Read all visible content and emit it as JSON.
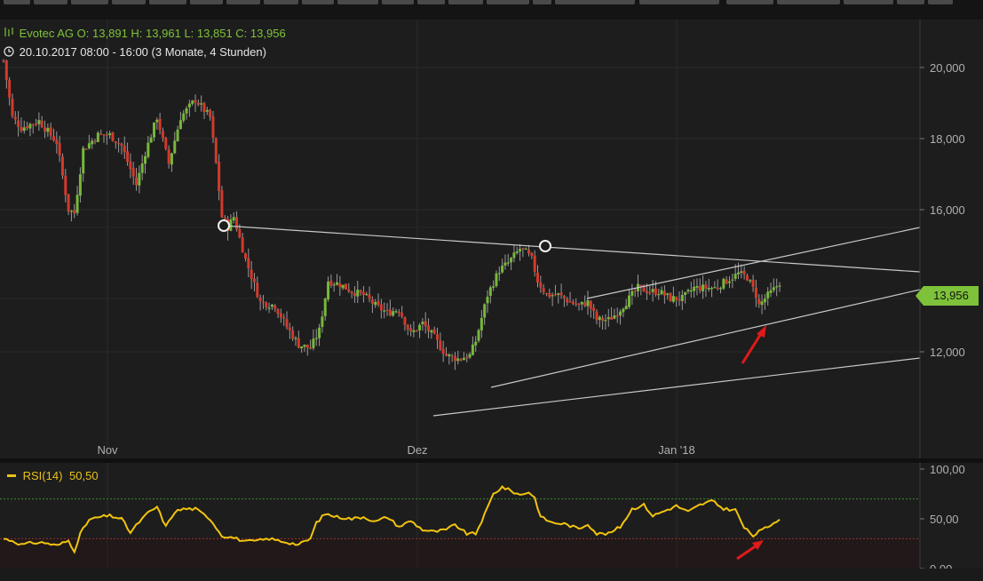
{
  "toolbar": {
    "button_count": 13
  },
  "instrument": {
    "name": "Evotec AG",
    "open_label": "O:",
    "open": "13,891",
    "high_label": "H:",
    "high": "13,961",
    "low_label": "L:",
    "low": "13,851",
    "close_label": "C:",
    "close": "13,956"
  },
  "session": {
    "text": "20.10.2017 08:00 - 16:00",
    "range": "(3 Monate, 4 Stunden)"
  },
  "colors": {
    "background": "#1d1d1d",
    "up_candle": "#76b83a",
    "down_candle": "#d23a2c",
    "wick": "#9a9a9a",
    "trendline": "#c8c8c8",
    "rsi_line": "#f1c30f",
    "rsi_upper_level": "#3c8a2c",
    "rsi_lower_level": "#9c2f2f",
    "annotation_arrow": "#e01a1a",
    "price_badge": "#7dc23a"
  },
  "chart_data": [
    {
      "type": "candlestick",
      "title": "Evotec AG",
      "y_axis_ticks": [
        "20,000",
        "18,000",
        "16,000",
        "12,000"
      ],
      "y_tick_values": [
        20,
        18,
        16,
        12
      ],
      "ylim": [
        10.3,
        21.3
      ],
      "x_tick_labels": [
        "Nov",
        "Dez",
        "Jan '18"
      ],
      "last_price_label": "13,956",
      "last_price": 13.956,
      "price_path": [
        [
          0,
          20.2
        ],
        [
          3,
          18.6
        ],
        [
          6,
          18.3
        ],
        [
          12,
          18.5
        ],
        [
          18,
          17.9
        ],
        [
          22,
          16.0
        ],
        [
          24,
          15.9
        ],
        [
          27,
          17.7
        ],
        [
          32,
          18.1
        ],
        [
          36,
          18.1
        ],
        [
          40,
          17.8
        ],
        [
          45,
          16.7
        ],
        [
          48,
          17.6
        ],
        [
          52,
          18.6
        ],
        [
          56,
          17.3
        ],
        [
          60,
          18.6
        ],
        [
          65,
          19.1
        ],
        [
          70,
          18.6
        ],
        [
          72,
          17.3
        ],
        [
          74,
          15.8
        ],
        [
          76,
          15.5
        ],
        [
          78,
          15.8
        ],
        [
          82,
          14.6
        ],
        [
          87,
          13.4
        ],
        [
          92,
          13.3
        ],
        [
          96,
          12.7
        ],
        [
          100,
          12.2
        ],
        [
          104,
          12.1
        ],
        [
          107,
          12.6
        ],
        [
          110,
          14.0
        ],
        [
          114,
          13.9
        ],
        [
          118,
          13.7
        ],
        [
          122,
          13.6
        ],
        [
          126,
          13.3
        ],
        [
          130,
          13.1
        ],
        [
          134,
          13.2
        ],
        [
          138,
          12.5
        ],
        [
          142,
          12.8
        ],
        [
          146,
          12.4
        ],
        [
          150,
          11.9
        ],
        [
          154,
          11.8
        ],
        [
          158,
          11.9
        ],
        [
          160,
          12.3
        ],
        [
          164,
          13.6
        ],
        [
          168,
          14.3
        ],
        [
          171,
          14.5
        ],
        [
          173,
          14.7
        ],
        [
          175,
          14.9
        ],
        [
          177,
          14.8
        ],
        [
          179,
          14.6
        ],
        [
          181,
          14.0
        ],
        [
          184,
          13.6
        ],
        [
          188,
          13.6
        ],
        [
          192,
          13.4
        ],
        [
          195,
          13.3
        ],
        [
          198,
          13.4
        ],
        [
          201,
          12.9
        ],
        [
          205,
          12.9
        ],
        [
          208,
          13.1
        ],
        [
          212,
          13.5
        ],
        [
          215,
          13.8
        ],
        [
          219,
          13.7
        ],
        [
          222,
          13.7
        ],
        [
          226,
          13.5
        ],
        [
          230,
          13.5
        ],
        [
          234,
          13.8
        ],
        [
          237,
          13.8
        ],
        [
          241,
          13.8
        ],
        [
          245,
          14.0
        ],
        [
          249,
          14.2
        ],
        [
          252,
          14.1
        ],
        [
          255,
          13.6
        ],
        [
          256,
          13.3
        ],
        [
          258,
          13.5
        ],
        [
          261,
          13.75
        ],
        [
          263,
          13.956
        ]
      ],
      "annotation": "red arrow at recent low"
    },
    {
      "type": "line",
      "title": "RSI(14)",
      "value_label": "50,50",
      "y_axis_ticks": [
        "100,00",
        "50,00",
        "0,00"
      ],
      "y_tick_values": [
        100,
        50,
        0
      ],
      "ylim": [
        0,
        100
      ],
      "levels": [
        70,
        30
      ],
      "series": [
        {
          "name": "RSI(14)",
          "values": [
            [
              0,
              30
            ],
            [
              3,
              28
            ],
            [
              6,
              24
            ],
            [
              10,
              26
            ],
            [
              14,
              26
            ],
            [
              18,
              23
            ],
            [
              22,
              28
            ],
            [
              24,
              18
            ],
            [
              26,
              35
            ],
            [
              29,
              49
            ],
            [
              33,
              52
            ],
            [
              36,
              53
            ],
            [
              40,
              50
            ],
            [
              43,
              36
            ],
            [
              46,
              47
            ],
            [
              49,
              56
            ],
            [
              52,
              62
            ],
            [
              55,
              42
            ],
            [
              58,
              57
            ],
            [
              61,
              60
            ],
            [
              65,
              60
            ],
            [
              70,
              50
            ],
            [
              74,
              33
            ],
            [
              78,
              31
            ],
            [
              82,
              27
            ],
            [
              86,
              28
            ],
            [
              90,
              30
            ],
            [
              95,
              27
            ],
            [
              100,
              24
            ],
            [
              104,
              30
            ],
            [
              106,
              46
            ],
            [
              109,
              55
            ],
            [
              113,
              52
            ],
            [
              118,
              50
            ],
            [
              122,
              52
            ],
            [
              126,
              47
            ],
            [
              130,
              52
            ],
            [
              134,
              42
            ],
            [
              138,
              48
            ],
            [
              142,
              39
            ],
            [
              146,
              37
            ],
            [
              150,
              39
            ],
            [
              153,
              44
            ],
            [
              157,
              35
            ],
            [
              160,
              35
            ],
            [
              163,
              54
            ],
            [
              166,
              75
            ],
            [
              169,
              82
            ],
            [
              172,
              78
            ],
            [
              175,
              74
            ],
            [
              178,
              77
            ],
            [
              180,
              71
            ],
            [
              182,
              52
            ],
            [
              186,
              46
            ],
            [
              190,
              45
            ],
            [
              195,
              40
            ],
            [
              198,
              45
            ],
            [
              201,
              35
            ],
            [
              205,
              35
            ],
            [
              209,
              42
            ],
            [
              213,
              60
            ],
            [
              217,
              64
            ],
            [
              220,
              53
            ],
            [
              224,
              58
            ],
            [
              228,
              63
            ],
            [
              232,
              57
            ],
            [
              236,
              64
            ],
            [
              240,
              68
            ],
            [
              244,
              60
            ],
            [
              248,
              59
            ],
            [
              251,
              41
            ],
            [
              254,
              33
            ],
            [
              256,
              37
            ],
            [
              259,
              42
            ],
            [
              261,
              46
            ],
            [
              263,
              50.5
            ]
          ]
        }
      ],
      "annotation": "red arrow at RSI dip"
    }
  ]
}
